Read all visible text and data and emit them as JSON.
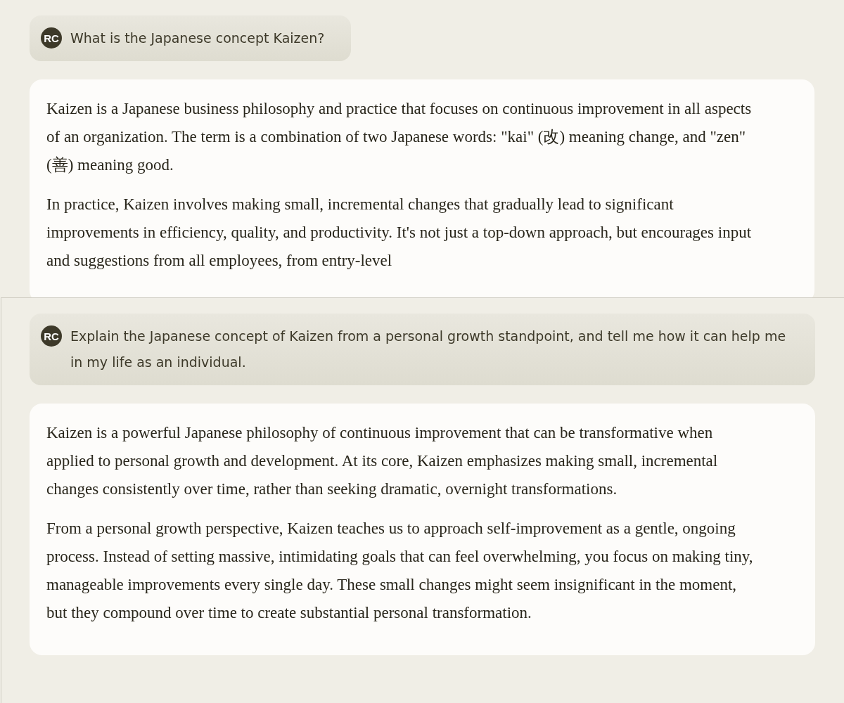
{
  "conversations": [
    {
      "user": {
        "initials": "RC",
        "text": "What is the Japanese concept Kaizen?"
      },
      "response": {
        "paragraphs": [
          "Kaizen is a Japanese business philosophy and practice that focuses on continuous improvement in all aspects of an organization. The term is a combination of two Japanese words: \"kai\" (改) meaning change, and \"zen\" (善) meaning good.",
          "In practice, Kaizen involves making small, incremental changes that gradually lead to significant improvements in efficiency, quality, and productivity. It's not just a top-down approach, but encourages input and suggestions from all employees, from entry-level"
        ]
      }
    },
    {
      "user": {
        "initials": "RC",
        "text": "Explain the Japanese concept of Kaizen from a personal growth standpoint, and tell me how it can help me in my life as an individual."
      },
      "response": {
        "paragraphs": [
          "Kaizen is a powerful Japanese philosophy of continuous improvement that can be transformative when applied to personal growth and development. At its core, Kaizen emphasizes making small, incremental changes consistently over time, rather than seeking dramatic, overnight transformations.",
          "From a personal growth perspective, Kaizen teaches us to approach self-improvement as a gentle, ongoing process. Instead of setting massive, intimidating goals that can feel overwhelming, you focus on making tiny, manageable improvements every single day. These small changes might seem insignificant in the moment, but they compound over time to create substantial personal transformation."
        ]
      }
    }
  ]
}
